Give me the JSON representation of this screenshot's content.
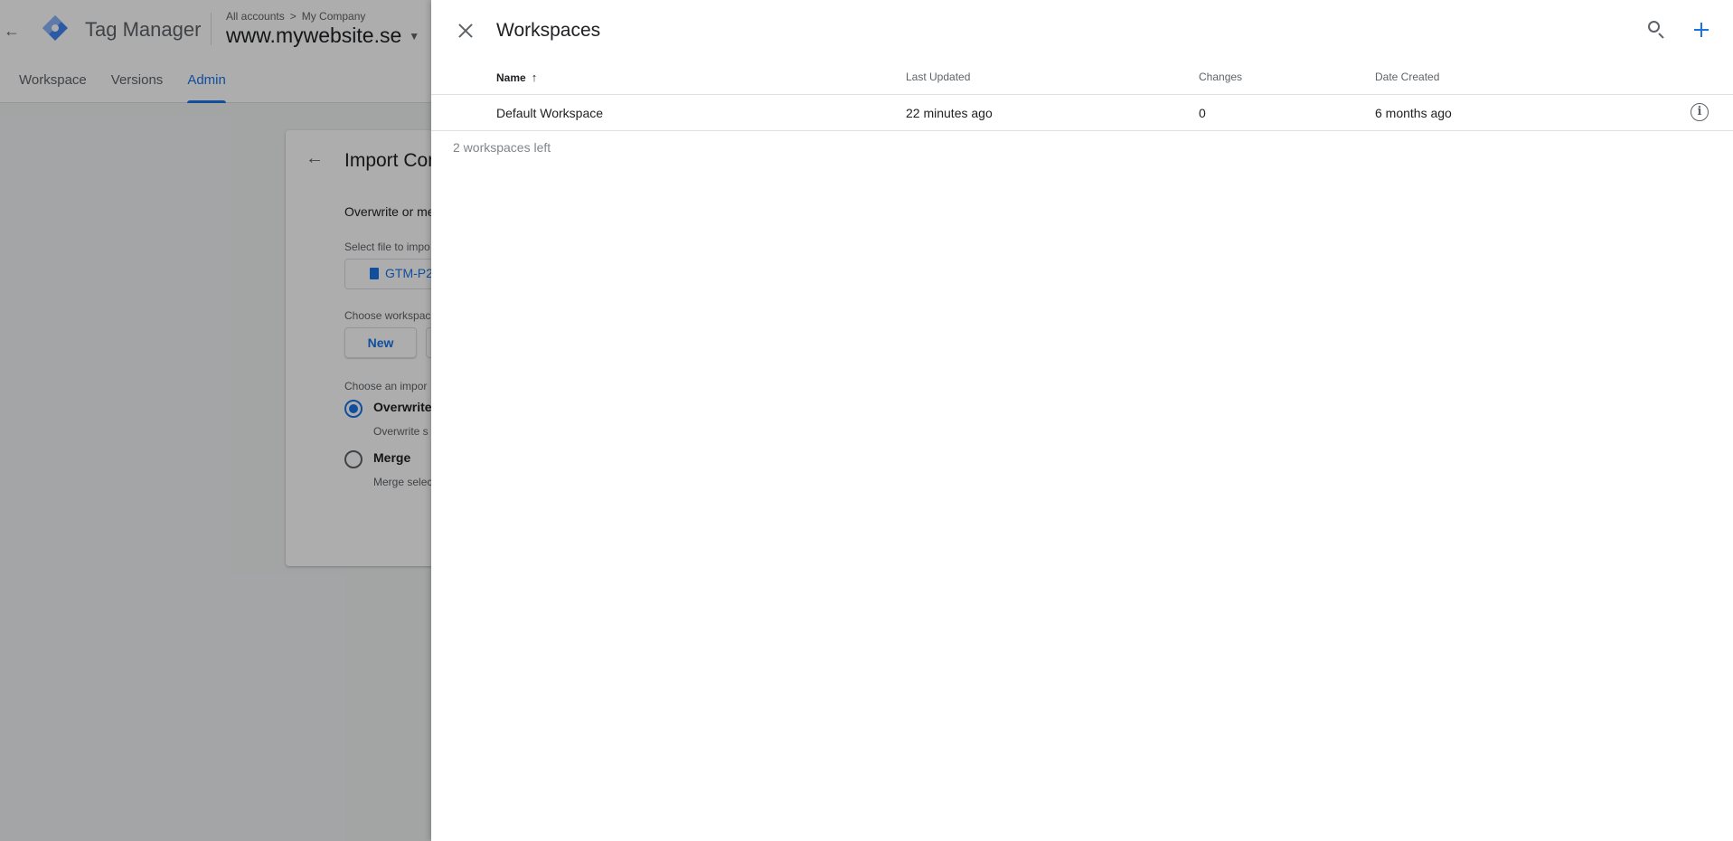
{
  "app": {
    "name": "Tag Manager",
    "breadcrumb": {
      "root": "All accounts",
      "separator": ">",
      "account": "My Company"
    },
    "container": "www.mywebsite.se",
    "nav_tabs": [
      {
        "label": "Workspace",
        "active": false
      },
      {
        "label": "Versions",
        "active": false
      },
      {
        "label": "Admin",
        "active": true
      }
    ]
  },
  "import_card": {
    "title": "Import Con",
    "description": "Overwrite or me",
    "file_label": "Select file to impo",
    "file_name": "GTM-P2",
    "workspace_label": "Choose workspac",
    "new_button": "New",
    "option_label": "Choose an impor",
    "overwrite_label": "Overwrite",
    "overwrite_desc": "Overwrite s",
    "merge_label": "Merge",
    "merge_desc": "Merge selec"
  },
  "panel": {
    "title": "Workspaces",
    "columns": {
      "name": "Name",
      "last_updated": "Last Updated",
      "changes": "Changes",
      "date_created": "Date Created"
    },
    "sort": {
      "column": "name",
      "direction": "ascending"
    },
    "rows": [
      {
        "name": "Default Workspace",
        "last_updated": "22 minutes ago",
        "changes": "0",
        "date_created": "6 months ago"
      }
    ],
    "footer": "2 workspaces left"
  },
  "colors": {
    "accent": "#1a73e8",
    "text": "#202124",
    "secondary": "#5f6368"
  },
  "icons": [
    "back-arrow-icon",
    "tag-manager-logo",
    "close-icon",
    "search-icon",
    "add-icon",
    "sort-arrow-up-icon",
    "info-icon",
    "file-icon"
  ]
}
